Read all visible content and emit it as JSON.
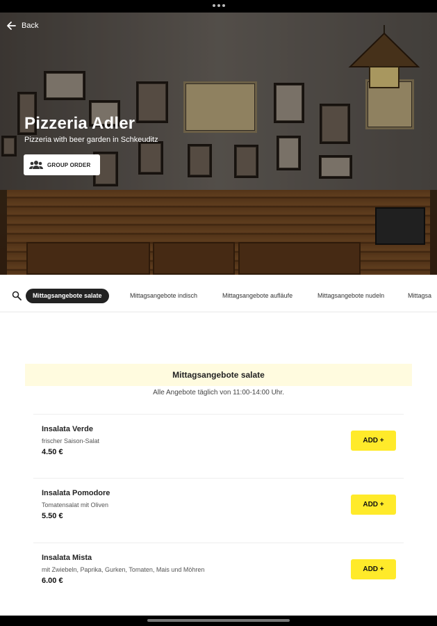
{
  "header": {
    "back_label": "Back"
  },
  "restaurant": {
    "name": "Pizzeria Adler",
    "tagline": "Pizzeria with beer garden in Schkeuditz",
    "group_order_label": "GROUP ORDER"
  },
  "category_tabs": [
    {
      "label": "Mittagsangebote salate",
      "active": true
    },
    {
      "label": "Mittagsangebote indisch",
      "active": false
    },
    {
      "label": "Mittagsangebote aufläufe",
      "active": false
    },
    {
      "label": "Mittagsangebote nudeln",
      "active": false
    },
    {
      "label": "Mittagsa",
      "active": false
    }
  ],
  "section": {
    "title": "Mittagsangebote salate",
    "description": "Alle Angebote täglich von 11:00-14:00 Uhr."
  },
  "menu_items": [
    {
      "name": "Insalata Verde",
      "description": "frischer Saison-Salat",
      "price": "4.50 €",
      "add_label": "ADD +"
    },
    {
      "name": "Insalata Pomodore",
      "description": "Tomatensalat mit Oliven",
      "price": "5.50 €",
      "add_label": "ADD +"
    },
    {
      "name": "Insalata Mista",
      "description": "mit Zwiebeln, Paprika, Gurken, Tomaten, Mais und Möhren",
      "price": "6.00 €",
      "add_label": "ADD +"
    }
  ],
  "colors": {
    "accent_yellow": "#ffea2a",
    "section_bg": "#fffbdf",
    "active_tab": "#222222"
  },
  "icons": {
    "back": "arrow-left-icon",
    "group": "group-icon",
    "search": "search-icon"
  }
}
